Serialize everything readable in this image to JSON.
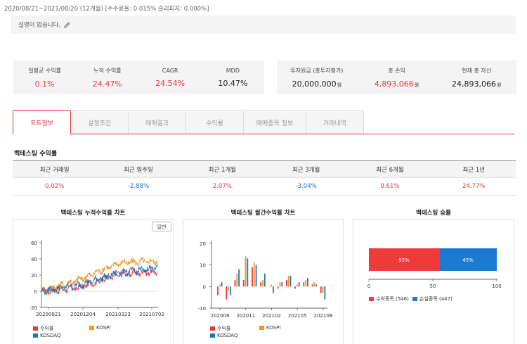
{
  "header": {
    "period": "2020/08/21~2021/08/20 (12개월) [수수료율: 0.015% 슬리피지: 0.000%]",
    "description": "설명이 없습니다."
  },
  "stats_left": [
    {
      "label": "일평균 수익률",
      "value": "0.1%"
    },
    {
      "label": "누적 수익률",
      "value": "24.47%"
    },
    {
      "label": "CAGR",
      "value": "24.54%"
    },
    {
      "label": "MDD",
      "value": "10.47%"
    }
  ],
  "stats_right": [
    {
      "label": "투자원금 (총투자평가)",
      "value": "20,000,000",
      "unit": "원"
    },
    {
      "label": "총 손익",
      "value": "4,893,066",
      "unit": "원"
    },
    {
      "label": "현재 총 자산",
      "value": "24,893,066",
      "unit": "원"
    }
  ],
  "tabs": [
    "포트정보",
    "설정조건",
    "매매결과",
    "수익률",
    "매매종목 정보",
    "거래내역"
  ],
  "returns": {
    "title": "백테스팅 수익률",
    "headers": [
      "최근 거래일",
      "최근 일주일",
      "최근 1개월",
      "최근 3개월",
      "최근 6개월",
      "최근 1년"
    ],
    "values": [
      "0.02%",
      "-2.88%",
      "2.07%",
      "-3.04%",
      "9.61%",
      "24.77%"
    ]
  },
  "charts": {
    "cumulative": {
      "title": "백테스팅 누적수익률 차트",
      "button": "일반",
      "yticks": [
        "60",
        "40",
        "20",
        "0",
        "-20"
      ],
      "xticks": [
        "20200821",
        "20201204",
        "20210323",
        "20210702"
      ]
    },
    "monthly": {
      "title": "백테스팅 월간수익률 차트",
      "yticks": [
        "20",
        "10",
        "0",
        "-10"
      ],
      "xticks": [
        "202008",
        "202011",
        "202102",
        "202105",
        "202108"
      ]
    },
    "winrate": {
      "title": "백테스팅 승률",
      "win_pct": "55%",
      "loss_pct": "45%",
      "xticks": [
        "0",
        "50",
        "100"
      ],
      "legend_win": "수익종목 (546)",
      "legend_loss": "손실종목 (447)"
    }
  },
  "legend": {
    "s1": "수익률",
    "s2": "KOSPI",
    "s3": "KOSDAQ"
  },
  "colors": {
    "red": "#e8383d",
    "orange": "#f7931e",
    "blue": "#1a78c2",
    "winbar": "#f0393a",
    "lossbar": "#1c7bd1"
  },
  "chart_data": [
    {
      "type": "line",
      "title": "백테스팅 누적수익률 차트",
      "x": [
        "20200821",
        "20201204",
        "20210323",
        "20210702"
      ],
      "ylim": [
        -20,
        60
      ],
      "series": [
        {
          "name": "수익률",
          "values": [
            0,
            5,
            22,
            24
          ]
        },
        {
          "name": "KOSPI",
          "values": [
            0,
            15,
            35,
            37
          ]
        },
        {
          "name": "KOSDAQ",
          "values": [
            0,
            8,
            22,
            29
          ]
        }
      ]
    },
    {
      "type": "bar",
      "title": "백테스팅 월간수익률 차트",
      "categories": [
        "202008",
        "202009",
        "202010",
        "202011",
        "202012",
        "202101",
        "202102",
        "202103",
        "202104",
        "202105",
        "202106",
        "202107",
        "202108"
      ],
      "ylim": [
        -10,
        20
      ],
      "series": [
        {
          "name": "수익률",
          "values": [
            -4,
            -6,
            3,
            3,
            9,
            2,
            0,
            -1,
            3,
            -1,
            2,
            1,
            -3
          ]
        },
        {
          "name": "KOSPI",
          "values": [
            1,
            -2,
            6,
            14,
            11,
            3,
            1,
            2,
            5,
            1,
            3,
            2,
            -3
          ]
        },
        {
          "name": "KOSDAQ",
          "values": [
            2,
            -4,
            8,
            13,
            10,
            6,
            -3,
            2,
            5,
            2,
            4,
            1,
            -6
          ]
        }
      ]
    },
    {
      "type": "bar",
      "title": "백테스팅 승률",
      "categories": [
        "수익종목",
        "손실종목"
      ],
      "values": [
        546,
        447
      ],
      "xlim": [
        0,
        100
      ]
    }
  ]
}
